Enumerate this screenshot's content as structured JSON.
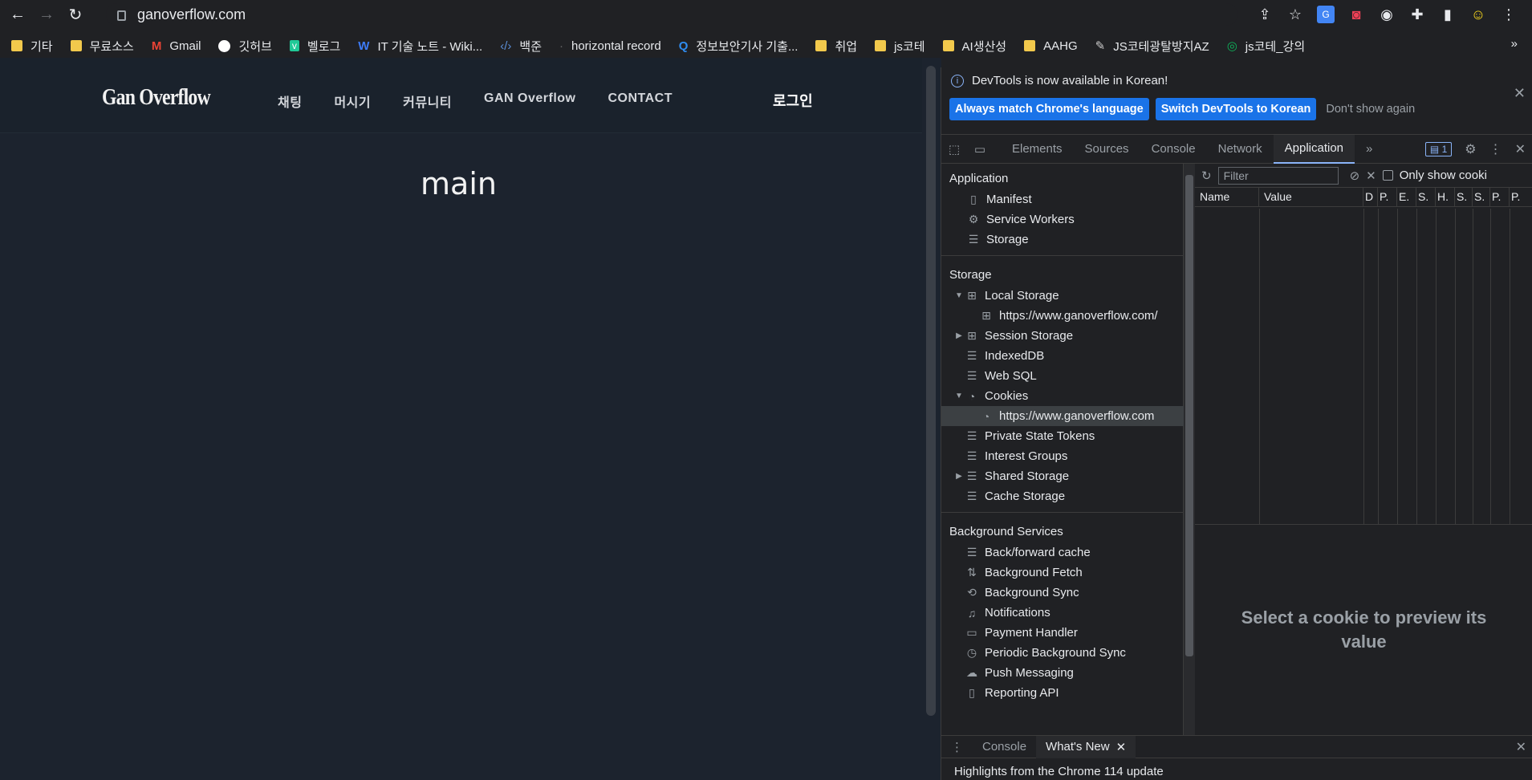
{
  "browser": {
    "url": "ganoverflow.com",
    "bookmarks": [
      "기타",
      "무료소스",
      "Gmail",
      "깃허브",
      "벨로그",
      "IT 기술 노트 - Wiki...",
      "백준",
      "horizontal record",
      "정보보안기사 기출...",
      "취업",
      "js코테",
      "AI생산성",
      "AAHG",
      "JS코테광탈방지AZ",
      "js코테_강의"
    ],
    "bookmarks_more": "»"
  },
  "site": {
    "logo": "Gan Overflow",
    "menu": [
      "채팅",
      "머시기",
      "커뮤니티",
      "GAN Overflow",
      "CONTACT"
    ],
    "login": "로그인",
    "main_heading": "main"
  },
  "devtools": {
    "info_message": "DevTools is now available in Korean!",
    "btn_match": "Always match Chrome's language",
    "btn_switch": "Switch DevTools to Korean",
    "btn_dont_show": "Don't show again",
    "tabs": [
      "Elements",
      "Sources",
      "Console",
      "Network",
      "Application"
    ],
    "active_tab": "Application",
    "issues_count": "1",
    "sidebar": {
      "application_header": "Application",
      "application_items": [
        "Manifest",
        "Service Workers",
        "Storage"
      ],
      "storage_header": "Storage",
      "storage_items": [
        "Local Storage",
        "https://www.ganoverflow.com/",
        "Session Storage",
        "IndexedDB",
        "Web SQL",
        "Cookies",
        "https://www.ganoverflow.com",
        "Private State Tokens",
        "Interest Groups",
        "Shared Storage",
        "Cache Storage"
      ],
      "background_header": "Background Services",
      "background_items": [
        "Back/forward cache",
        "Background Fetch",
        "Background Sync",
        "Notifications",
        "Payment Handler",
        "Periodic Background Sync",
        "Push Messaging",
        "Reporting API"
      ]
    },
    "cookies": {
      "filter_placeholder": "Filter",
      "only_show_label": "Only show cooki",
      "columns": [
        "Name",
        "Value",
        "D",
        "P.",
        "E.",
        "S.",
        "H.",
        "S.",
        "S.",
        "P.",
        "P."
      ],
      "preview_text": "Select a cookie to preview its value"
    },
    "drawer": {
      "tabs": [
        "Console",
        "What's New"
      ],
      "whats_new": "Highlights from the Chrome 114 update"
    }
  }
}
